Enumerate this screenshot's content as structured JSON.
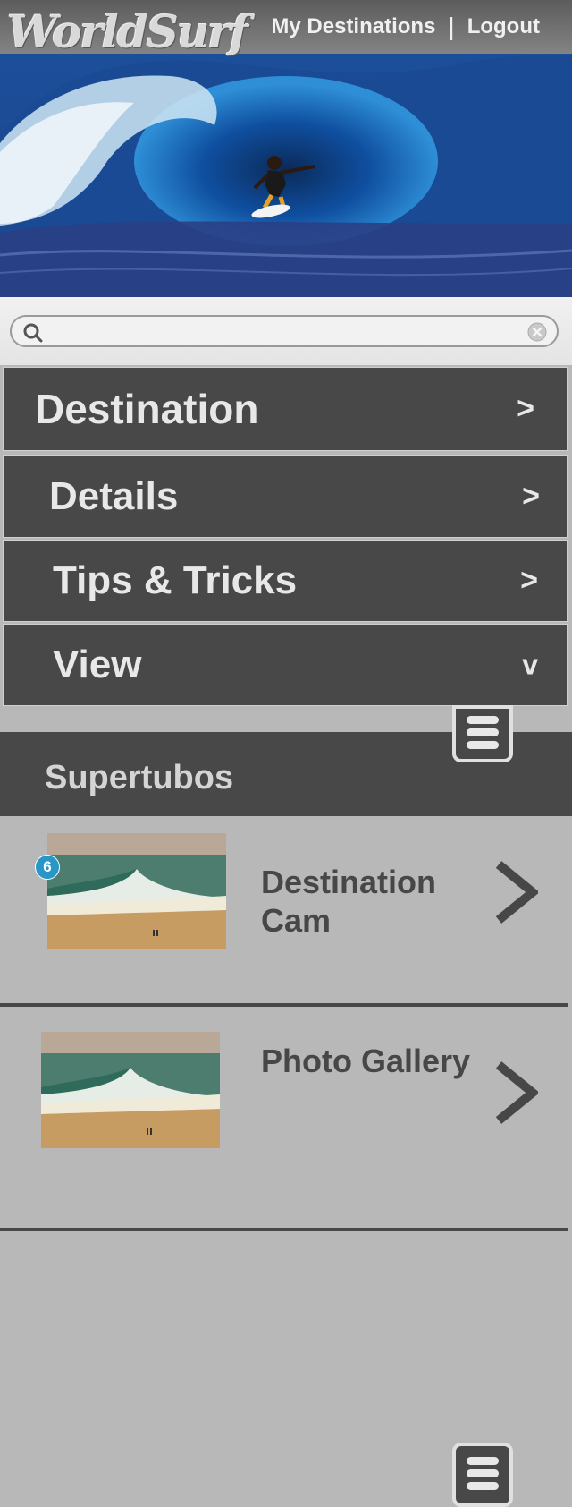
{
  "header": {
    "logo_text": "WorldSurf",
    "nav": {
      "my_destinations": "My Destinations",
      "separator": "|",
      "logout": "Logout"
    }
  },
  "search": {
    "placeholder": ""
  },
  "menu": [
    {
      "label": "Destination",
      "indicator": ">"
    },
    {
      "label": "Details",
      "indicator": ">"
    },
    {
      "label": "Tips & Tricks",
      "indicator": ">"
    },
    {
      "label": "View",
      "indicator": "v"
    }
  ],
  "section": {
    "title": "Supertubos"
  },
  "items": [
    {
      "label_line1": "Destination",
      "label_line2": "Cam",
      "badge": "6"
    },
    {
      "label_line1": "Photo Gallery"
    }
  ],
  "colors": {
    "menu_bg": "#484848",
    "page_bg": "#b8b8b8",
    "badge": "#2996c8",
    "text_dark": "#474747"
  }
}
